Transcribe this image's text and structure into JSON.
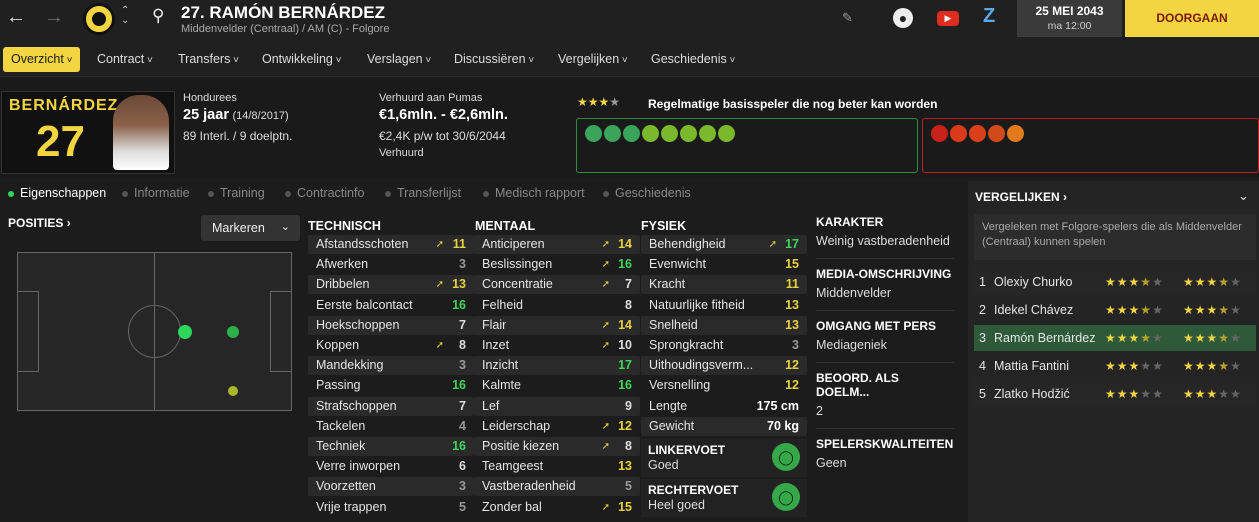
{
  "topbar": {
    "player_title": "27. RAMÓN BERNÁRDEZ",
    "player_sub": "Middenvelder (Centraal) / AM (C) - Folgore",
    "date": "25 MEI 2043",
    "time": "ma 12:00",
    "continue_label": "DOORGAAN"
  },
  "nav": {
    "items": [
      "Overzicht",
      "Contract",
      "Transfers",
      "Ontwikkeling",
      "Verslagen",
      "Discussiëren",
      "Vergelijken",
      "Geschiedenis"
    ]
  },
  "header": {
    "shirt_name": "BERNÁRDEZ",
    "shirt_number": "27",
    "nationality": "Hondurees",
    "age": "25 jaar",
    "dob": "(14/8/2017)",
    "caps": "89 Interl. / 9 doelptn.",
    "loan_status": "Verhuurd aan Pumas",
    "value": "€1,6mln. - €2,6mln.",
    "wage": "€2,4K p/w tot 30/6/2044",
    "status": "Verhuurd",
    "rating_text": "Regelmatige basisspeler die nog beter kan worden",
    "rating_stars": 3.5
  },
  "subtabs": [
    "Eigenschappen",
    "Informatie",
    "Training",
    "Contractinfo",
    "Transferlijst",
    "Medisch rapport",
    "Geschiedenis"
  ],
  "positions": {
    "title": "POSITIES",
    "dropdown": "Markeren"
  },
  "technical": {
    "title": "TECHNISCH",
    "rows": [
      {
        "name": "Afstandsschoten",
        "val": "11",
        "arrow": true,
        "c": "y"
      },
      {
        "name": "Afwerken",
        "val": "3",
        "arrow": false,
        "c": "d"
      },
      {
        "name": "Dribbelen",
        "val": "13",
        "arrow": true,
        "c": "y"
      },
      {
        "name": "Eerste balcontact",
        "val": "16",
        "arrow": false,
        "c": "g"
      },
      {
        "name": "Hoekschoppen",
        "val": "7",
        "arrow": false,
        "c": ""
      },
      {
        "name": "Koppen",
        "val": "8",
        "arrow": true,
        "c": ""
      },
      {
        "name": "Mandekking",
        "val": "3",
        "arrow": false,
        "c": "d"
      },
      {
        "name": "Passing",
        "val": "16",
        "arrow": false,
        "c": "g"
      },
      {
        "name": "Strafschoppen",
        "val": "7",
        "arrow": false,
        "c": ""
      },
      {
        "name": "Tackelen",
        "val": "4",
        "arrow": false,
        "c": "d"
      },
      {
        "name": "Techniek",
        "val": "16",
        "arrow": false,
        "c": "g"
      },
      {
        "name": "Verre inworpen",
        "val": "6",
        "arrow": false,
        "c": ""
      },
      {
        "name": "Voorzetten",
        "val": "3",
        "arrow": false,
        "c": "d"
      },
      {
        "name": "Vrije trappen",
        "val": "5",
        "arrow": false,
        "c": "d"
      }
    ]
  },
  "mental": {
    "title": "MENTAAL",
    "rows": [
      {
        "name": "Anticiperen",
        "val": "14",
        "arrow": true,
        "c": "y"
      },
      {
        "name": "Beslissingen",
        "val": "16",
        "arrow": true,
        "c": "g"
      },
      {
        "name": "Concentratie",
        "val": "7",
        "arrow": true,
        "c": ""
      },
      {
        "name": "Felheid",
        "val": "8",
        "arrow": false,
        "c": ""
      },
      {
        "name": "Flair",
        "val": "14",
        "arrow": true,
        "c": "y"
      },
      {
        "name": "Inzet",
        "val": "10",
        "arrow": true,
        "c": ""
      },
      {
        "name": "Inzicht",
        "val": "17",
        "arrow": false,
        "c": "g"
      },
      {
        "name": "Kalmte",
        "val": "16",
        "arrow": false,
        "c": "g"
      },
      {
        "name": "Lef",
        "val": "9",
        "arrow": false,
        "c": ""
      },
      {
        "name": "Leiderschap",
        "val": "12",
        "arrow": true,
        "c": "y"
      },
      {
        "name": "Positie kiezen",
        "val": "8",
        "arrow": true,
        "c": ""
      },
      {
        "name": "Teamgeest",
        "val": "13",
        "arrow": false,
        "c": "y"
      },
      {
        "name": "Vastberadenheid",
        "val": "5",
        "arrow": false,
        "c": "d"
      },
      {
        "name": "Zonder bal",
        "val": "15",
        "arrow": true,
        "c": "y"
      }
    ]
  },
  "physical": {
    "title": "FYSIEK",
    "rows": [
      {
        "name": "Behendigheid",
        "val": "17",
        "arrow": true,
        "c": "g"
      },
      {
        "name": "Evenwicht",
        "val": "15",
        "arrow": false,
        "c": "y"
      },
      {
        "name": "Kracht",
        "val": "11",
        "arrow": false,
        "c": "y"
      },
      {
        "name": "Natuurlijke fitheid",
        "val": "13",
        "arrow": false,
        "c": "y"
      },
      {
        "name": "Snelheid",
        "val": "13",
        "arrow": false,
        "c": "y"
      },
      {
        "name": "Sprongkracht",
        "val": "3",
        "arrow": false,
        "c": "d"
      },
      {
        "name": "Uithoudingsverm...",
        "val": "12",
        "arrow": false,
        "c": "y"
      },
      {
        "name": "Versnelling",
        "val": "12",
        "arrow": false,
        "c": "y"
      }
    ],
    "length_label": "Lengte",
    "length": "175 cm",
    "weight_label": "Gewicht",
    "weight": "70 kg",
    "left_foot_label": "LINKERVOET",
    "left_foot": "Goed",
    "right_foot_label": "RECHTERVOET",
    "right_foot": "Heel goed"
  },
  "info": {
    "character_label": "KARAKTER",
    "character": "Weinig vastberadenheid",
    "media_label": "MEDIA-OMSCHRIJVING",
    "media": "Middenvelder",
    "press_label": "OMGANG MET PERS",
    "press": "Mediageniek",
    "gk_label": "BEOORD. ALS DOELM...",
    "gk": "2",
    "qualities_label": "SPELERSKWALITEITEN",
    "qualities": "Geen"
  },
  "compare": {
    "title": "VERGELIJKEN",
    "desc": "Vergeleken met Folgore-spelers die als Middenvelder (Centraal) kunnen spelen",
    "rows": [
      {
        "rank": "1",
        "name": "Olexiy Churko",
        "ca": 3.5,
        "pa": 3.5
      },
      {
        "rank": "2",
        "name": "Idekel Chávez",
        "ca": 3.5,
        "pa": 3.5
      },
      {
        "rank": "3",
        "name": "Ramón Bernárdez",
        "ca": 3.5,
        "pa": 3.5
      },
      {
        "rank": "4",
        "name": "Mattia Fantini",
        "ca": 3,
        "pa": 3.5
      },
      {
        "rank": "5",
        "name": "Zlatko Hodžić",
        "ca": 3,
        "pa": 3
      }
    ]
  },
  "colors": {
    "accent": "#f3d542",
    "green": "#3dd65b",
    "red": "#c8201a"
  }
}
